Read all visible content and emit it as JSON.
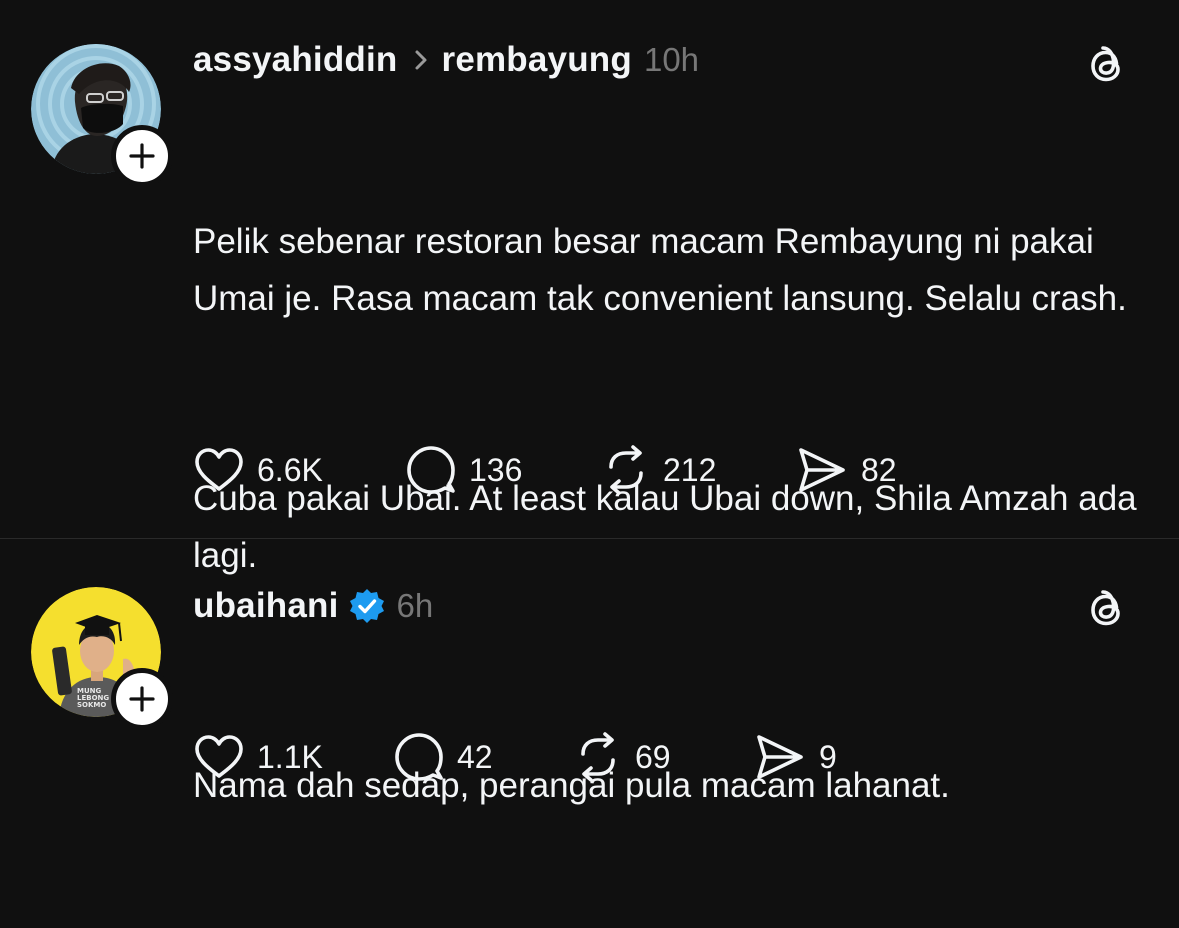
{
  "posts": [
    {
      "username": "assyahiddin",
      "reply_to": "rembayung",
      "time": "10h",
      "paragraphs": [
        "Pelik sebenar restoran besar macam Rembayung ni pakai Umai je. Rasa macam tak convenient lansung. Selalu crash.",
        "Cuba pakai Ubai. At least kalau Ubai down, Shila Amzah ada lagi."
      ],
      "counts": {
        "likes": "6.6K",
        "comments": "136",
        "reposts": "212",
        "shares": "82"
      }
    },
    {
      "username": "ubaihani",
      "verified": true,
      "time": "6h",
      "paragraphs": [
        "Nama dah sedap, perangai pula macam lahanat."
      ],
      "counts": {
        "likes": "1.1K",
        "comments": "42",
        "reposts": "69",
        "shares": "9"
      }
    }
  ],
  "avatar2_shirt_text": "MUNG LEBONG SOKMO",
  "colors": {
    "background": "#101010",
    "text": "#f3f5f7",
    "muted": "#777777",
    "verified": "#1d9bf0",
    "divider": "#2a2a2a"
  }
}
